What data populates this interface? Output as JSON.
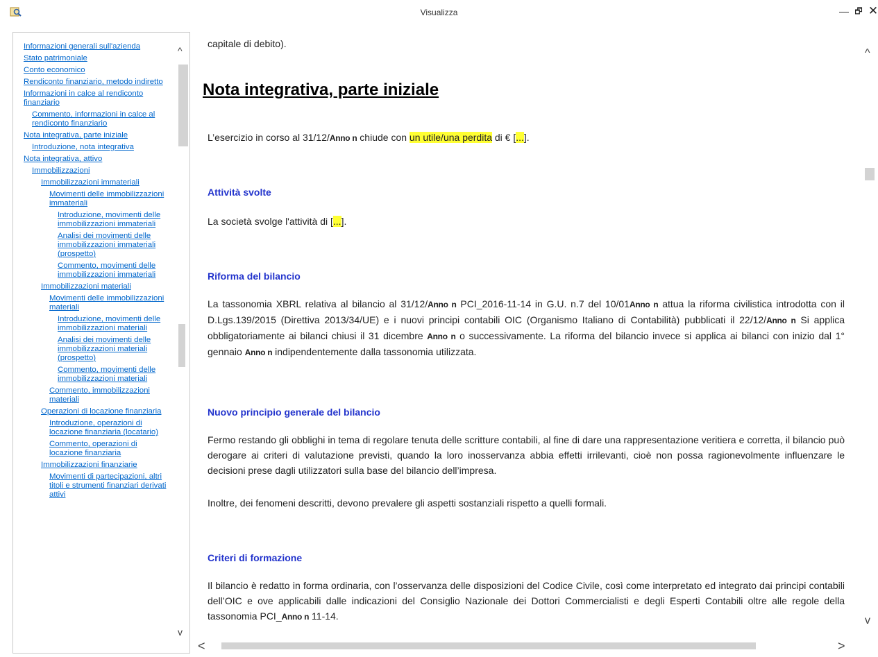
{
  "window": {
    "title": "Visualizza",
    "minimize": "—",
    "maximize": "🗗",
    "close": "✕",
    "app_icon": "document-search-icon"
  },
  "sidebar": {
    "items": [
      {
        "label": "Informazioni generali sull'azienda",
        "level": 0
      },
      {
        "label": "Stato patrimoniale",
        "level": 0
      },
      {
        "label": "Conto economico",
        "level": 0
      },
      {
        "label": "Rendiconto finanziario, metodo indiretto",
        "level": 0
      },
      {
        "label": "Informazioni in calce al rendiconto finanziario",
        "level": 0
      },
      {
        "label": "Commento, informazioni in calce al rendiconto finanziario",
        "level": 1
      },
      {
        "label": "Nota integrativa, parte iniziale",
        "level": 0
      },
      {
        "label": "Introduzione, nota integrativa",
        "level": 1
      },
      {
        "label": "Nota integrativa, attivo",
        "level": 0
      },
      {
        "label": "Immobilizzazioni",
        "level": 1
      },
      {
        "label": "Immobilizzazioni immateriali",
        "level": 2
      },
      {
        "label": "Movimenti delle immobilizzazioni immateriali",
        "level": 3
      },
      {
        "label": "Introduzione, movimenti delle immobilizzazioni immateriali",
        "level": 4
      },
      {
        "label": "Analisi dei movimenti delle immobilizzazioni immateriali (prospetto)",
        "level": 4
      },
      {
        "label": "Commento, movimenti delle immobilizzazioni immateriali",
        "level": 4
      },
      {
        "label": "Immobilizzazioni materiali",
        "level": 2
      },
      {
        "label": "Movimenti delle immobilizzazioni materiali",
        "level": 3
      },
      {
        "label": "Introduzione, movimenti delle immobilizzazioni materiali",
        "level": 4
      },
      {
        "label": "Analisi dei movimenti delle immobilizzazioni materiali (prospetto)",
        "level": 4
      },
      {
        "label": "Commento, movimenti delle immobilizzazioni materiali",
        "level": 4
      },
      {
        "label": "Commento, immobilizzazioni materiali",
        "level": 3
      },
      {
        "label": "Operazioni di locazione finanziaria",
        "level": 2
      },
      {
        "label": "Introduzione, operazioni di locazione finanziaria (locatario)",
        "level": 3
      },
      {
        "label": "Commento, operazioni di locazione finanziaria",
        "level": 3
      },
      {
        "label": "Immobilizzazioni finanziarie",
        "level": 2
      },
      {
        "label": "Movimenti di partecipazioni, altri titoli e strumenti finanziari derivati attivi",
        "level": 3
      }
    ]
  },
  "document": {
    "top_fragment": "capitale di debito).",
    "heading": "Nota integrativa, parte iniziale",
    "intro": {
      "pre": "L’esercizio in corso al 31/12/",
      "tag": "Anno n",
      "mid": " chiude con ",
      "highlight": "un utile/una perdita",
      "post": " di € [",
      "placeholder": "...",
      "end": "]."
    },
    "sections": {
      "attivita": {
        "title": "Attività svolte",
        "text_pre": "La società svolge l'attività di [",
        "placeholder": "...",
        "text_post": "]."
      },
      "riforma": {
        "title": "Riforma del bilancio",
        "p1": "La tassonomia XBRL relativa al bilancio al 31/12/",
        "t1": "Anno n",
        "p2": " PCI_2016-11-14 in G.U. n.7 del 10/01",
        "t2": "Anno n",
        "p3": " attua la riforma civilistica introdotta con il D.Lgs.139/2015 (Direttiva 2013/34/UE) e i nuovi principi contabili OIC (Organismo Italiano di Contabilità) pubblicati il 22/12/",
        "t3": "Anno n",
        "p4": " Si applica obbligatoriamente ai bilanci chiusi il 31 dicembre ",
        "t4": "Anno n",
        "p5": " o successivamente. La riforma del bilancio invece si applica ai bilanci con inizio dal 1° gennaio ",
        "t5": "Anno n",
        "p6": " indipendentemente dalla tassonomia utilizzata."
      },
      "principio": {
        "title": "Nuovo principio generale del bilancio",
        "para1": "Fermo restando gli obblighi in tema di regolare tenuta delle scritture contabili, al fine di dare una rappresentazione veritiera e corretta, il bilancio può derogare ai criteri di valutazione previsti, quando la loro inosservanza abbia effetti irrilevanti, cioè non possa ragionevolmente influenzare le decisioni prese dagli utilizzatori sulla base del bilancio dell’impresa.",
        "para2": "Inoltre, dei fenomeni descritti, devono prevalere gli aspetti sostanziali rispetto a quelli formali."
      },
      "criteri": {
        "title": "Criteri di formazione",
        "p1": "Il bilancio è redatto in forma ordinaria, con l’osservanza delle disposizioni del Codice Civile, così come interpretato ed integrato dai principi contabili dell’OIC e ove applicabili dalle indicazioni del Consiglio Nazionale dei Dottori Commercialisti e degli Esperti Contabili oltre alle regole della tassonomia PCI_",
        "tag": "Anno n",
        "p2": " 11-14."
      }
    }
  },
  "scrollbars": {
    "up": "^",
    "down": "v",
    "left": "<",
    "right": ">"
  }
}
